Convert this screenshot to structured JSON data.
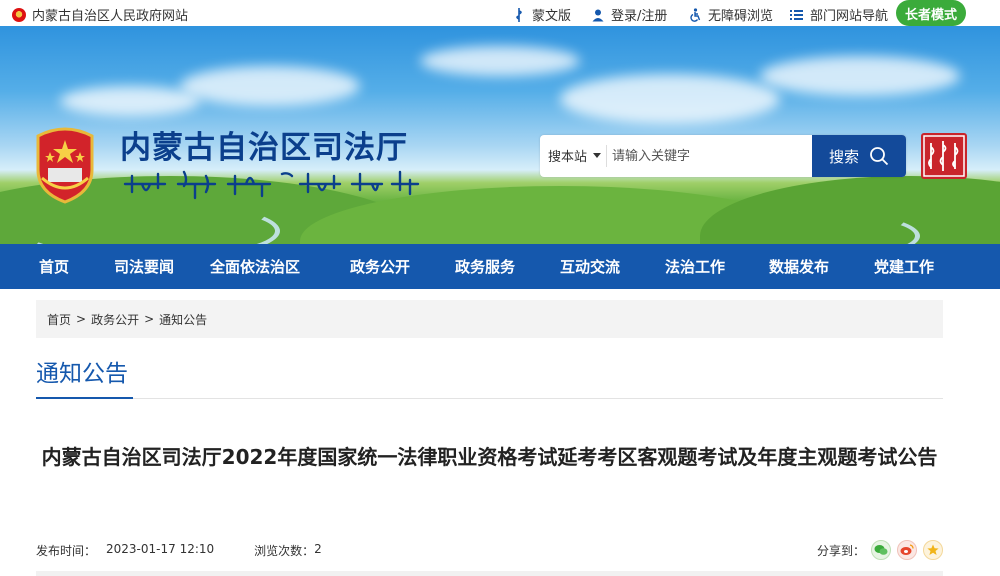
{
  "topbar": {
    "site_name": "内蒙古自治区人民政府网站",
    "mongolian": "蒙文版",
    "login": "登录/注册",
    "accessible": "无障碍浏览",
    "dept_nav": "部门网站导航",
    "elder_mode": "长者模式"
  },
  "header": {
    "title": "内蒙古自治区司法厅",
    "emblem_text": "中国司法"
  },
  "search": {
    "scope": "搜本站",
    "placeholder": "请输入关键字",
    "button": "搜索"
  },
  "nav": {
    "items": [
      "首页",
      "司法要闻",
      "全面依法治区",
      "政务公开",
      "政务服务",
      "互动交流",
      "法治工作",
      "数据发布",
      "党建工作"
    ]
  },
  "breadcrumb": {
    "home": "首页",
    "level1": "政务公开",
    "level2": "通知公告",
    "sep": ">"
  },
  "section": {
    "title": "通知公告"
  },
  "article": {
    "title": "内蒙古自治区司法厅2022年度国家统一法律职业资格考试延考考区客观题考试及年度主观题考试公告",
    "publish_label": "发布时间：",
    "publish_time": "2023-01-17 12:10",
    "views_label": "浏览次数：",
    "views": "2",
    "share_label": "分享到："
  },
  "colors": {
    "nav_blue": "#1558ad",
    "elder_green": "#3bab3b",
    "title_blue": "#0b3f8c"
  },
  "icons": {
    "share": [
      "wechat-icon",
      "weibo-icon",
      "qzone-icon"
    ]
  }
}
